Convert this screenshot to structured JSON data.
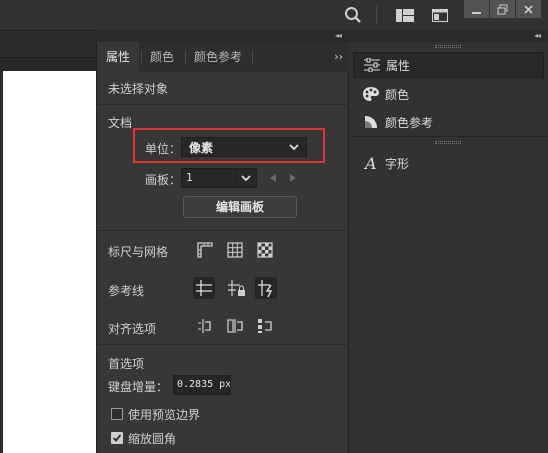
{
  "toolbar": {
    "search_icon": "search-icon",
    "arrange_icon": "arrange-documents-icon",
    "panels_icon": "workspace-icon",
    "window_controls": [
      "minimize",
      "restore",
      "close"
    ]
  },
  "collapse_glyph": "◂◂",
  "properties_panel": {
    "tabs": [
      {
        "label": "属性",
        "active": true
      },
      {
        "label": "颜色",
        "active": false
      },
      {
        "label": "颜色参考",
        "active": false
      }
    ],
    "menu_glyph": "››",
    "no_selection": "未选择对象",
    "document": {
      "heading": "文档",
      "unit_label": "单位：",
      "unit_value": "像素",
      "artboard_label": "画板：",
      "artboard_value": "1",
      "edit_artboards": "编辑画板"
    },
    "rulers_grids": {
      "label": "标尺与网格"
    },
    "guides": {
      "label": "参考线"
    },
    "align_options": {
      "label": "对齐选项"
    },
    "preferences": {
      "heading": "首选项",
      "keyboard_increment_label": "键盘增量：",
      "keyboard_increment_value": "0.2835 px",
      "preview_bounds_label": "使用预览边界",
      "preview_bounds_checked": false,
      "scale_corners_label": "缩放圆角",
      "scale_corners_checked": true
    }
  },
  "right_panel": {
    "items": [
      {
        "label": "属性",
        "icon": "properties-icon",
        "active": true
      },
      {
        "label": "颜色",
        "icon": "color-palette-icon",
        "active": false
      },
      {
        "label": "颜色参考",
        "icon": "color-guide-icon",
        "active": false
      }
    ],
    "character": {
      "label": "字形",
      "icon": "character-icon"
    }
  },
  "colors": {
    "highlight": "#e03535",
    "panel": "#373737",
    "dark": "#323232"
  }
}
